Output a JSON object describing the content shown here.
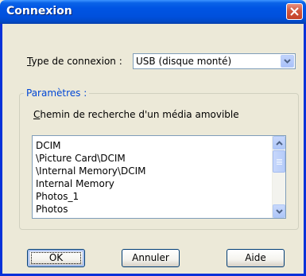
{
  "window": {
    "title": "Connexion",
    "close_icon": "close-icon"
  },
  "connection_type": {
    "label_accel": "T",
    "label_rest": "ype de connexion :",
    "selected": "USB (disque monté)"
  },
  "settings": {
    "group_label": "Paramètres :",
    "search_path_label_accel": "C",
    "search_path_label_rest": "hemin de recherche d'un média amovible",
    "paths": [
      "DCIM",
      "\\Picture Card\\DCIM",
      "\\Internal Memory\\DCIM",
      "Internal Memory",
      "Photos_1",
      "Photos"
    ]
  },
  "buttons": {
    "ok": "OK",
    "cancel": "Annuler",
    "help": "Aide"
  },
  "colors": {
    "titlebar": "#0054E3",
    "window_bg": "#ECE9D8",
    "group_label": "#0046D5",
    "close_button": "#C44228"
  }
}
